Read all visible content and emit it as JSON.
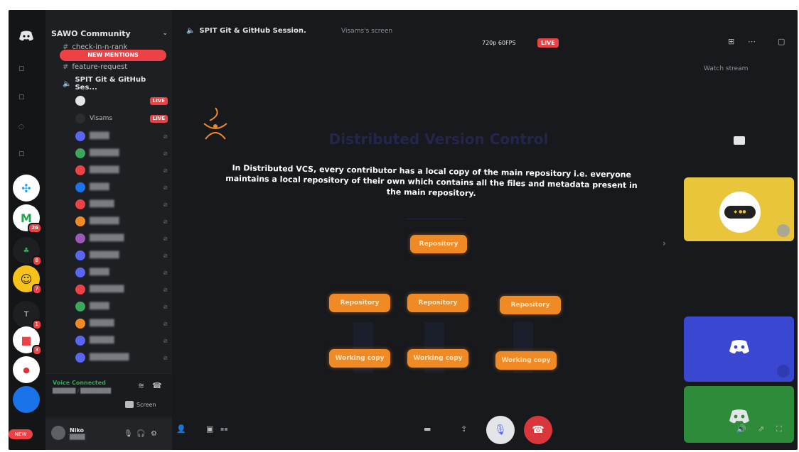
{
  "server": {
    "name": "SAWO Community",
    "new_mentions": "NEW MENTIONS",
    "channels": [
      {
        "name": "check-in-n-rank"
      },
      {
        "name": "feature-request"
      },
      {
        "name": "SPIT Git & GitHub Ses..."
      }
    ]
  },
  "voice_users": [
    {
      "name": "",
      "live": "LIVE",
      "color": "#e3e5e8"
    },
    {
      "name": "Visams",
      "live": "LIVE",
      "color": "#2b2d31"
    }
  ],
  "rail": {
    "badges": [
      "26",
      "8",
      "7",
      "1",
      "3"
    ],
    "new_label": "NEW"
  },
  "voice_panel": {
    "status": "Voice Connected",
    "screen_label": "Screen"
  },
  "user_panel": {
    "name": "Niko"
  },
  "stream": {
    "channel": "SPIT Git & GitHub Session.",
    "viewer": "Visams's screen",
    "quality": "720p 60FPS",
    "live": "LIVE",
    "watch": "Watch stream"
  },
  "slide": {
    "title": "Distributed Version Control",
    "body": "In Distributed VCS, every contributor has a local copy of the main repository i.e. everyone maintains a local repository of their own which contains all the files and metadata present in the main repository.",
    "top_node": "Repository",
    "mid_nodes": [
      "Repository",
      "Repository",
      "Repository"
    ],
    "bottom_nodes": [
      "Working copy",
      "Working copy",
      "Working copy"
    ],
    "accent": "#f08a24"
  },
  "colors": {
    "live_red": "#ed4245",
    "online_green": "#3ba55c",
    "tile_yellow": "#e8c53a",
    "tile_blue": "#3a47d0",
    "tile_green": "#2e8b3a"
  }
}
